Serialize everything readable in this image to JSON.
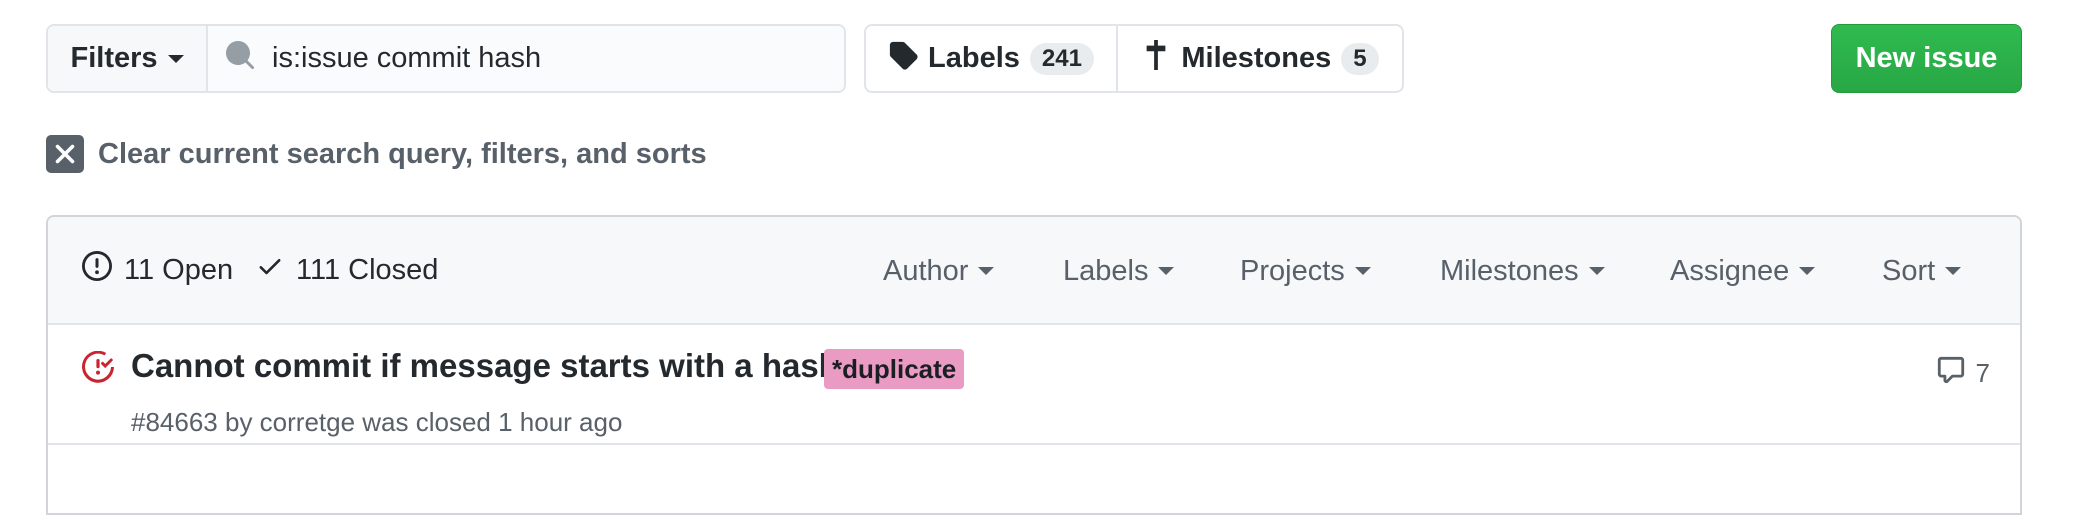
{
  "toolbar": {
    "filters_label": "Filters",
    "search_value": "is:issue commit hash",
    "labels_label": "Labels",
    "labels_count": "241",
    "milestones_label": "Milestones",
    "milestones_count": "5",
    "new_issue_label": "New issue"
  },
  "clear_query": {
    "label": "Clear current search query, filters, and sorts"
  },
  "issues_header": {
    "open_label": "11 Open",
    "closed_label": "111 Closed",
    "filters": [
      "Author",
      "Labels",
      "Projects",
      "Milestones",
      "Assignee",
      "Sort"
    ]
  },
  "issues": [
    {
      "title": "Cannot commit if message starts with a hash",
      "label": "*duplicate",
      "label_color": "#e99bc4",
      "meta": "#84663 by corretge was closed 1 hour ago",
      "comments": "7",
      "state_icon": "issue-closed-icon"
    }
  ],
  "colors": {
    "accent_green": "#28a745",
    "closed_red": "#cb2431",
    "muted": "#586069"
  }
}
